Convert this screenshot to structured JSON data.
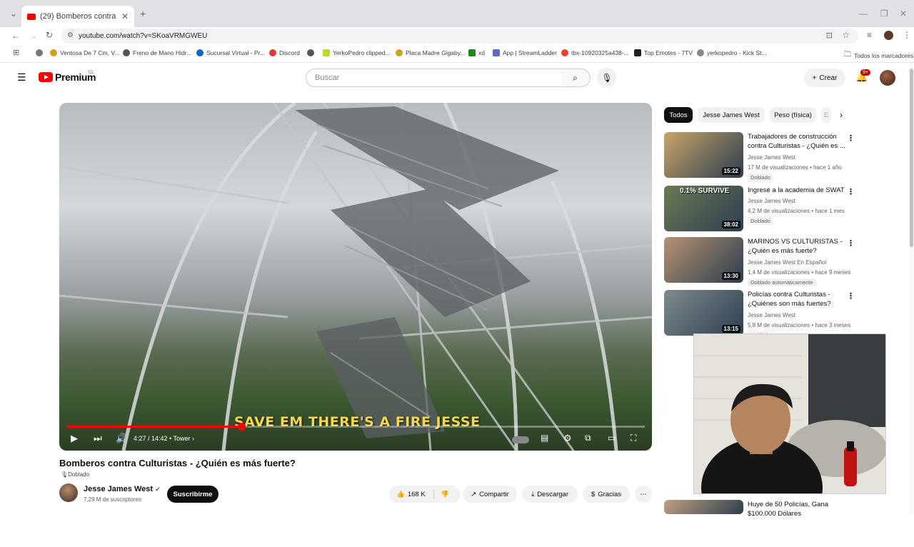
{
  "browser": {
    "tab_title": "(29) Bomberos contra Culturist",
    "url": "youtube.com/watch?v=SKoaVRMGWEU",
    "bookmarks": [
      {
        "label": "Ventosa De 7 Cm, V...",
        "color": "#d4a017"
      },
      {
        "label": "Freno de Mano Hidr...",
        "color": "#555555"
      },
      {
        "label": "Sucursal Virtual - Pr...",
        "color": "#1565c0"
      },
      {
        "label": "Discord",
        "color": "#e53935"
      },
      {
        "label": "",
        "color": "#555555"
      },
      {
        "label": "YerkoPedro clipped...",
        "color": "#c6d629"
      },
      {
        "label": "Placa Madre Gigaby...",
        "color": "#d4a017"
      },
      {
        "label": "xd",
        "color": "#1b8a1b"
      },
      {
        "label": "App | StreamLadder",
        "color": "#5c6bc0"
      },
      {
        "label": "tbx-10920325a438-...",
        "color": "#ea4335"
      },
      {
        "label": "Top Emotes - 7TV",
        "color": "#222222"
      },
      {
        "label": "yerkopedro - Kick St...",
        "color": "#888888"
      }
    ],
    "all_bookmarks": "Todos los marcadores"
  },
  "youtube": {
    "logo_text": "Premium",
    "logo_country": "CL",
    "search_placeholder": "Buscar",
    "create_label": "Crear",
    "notif_count": "9+"
  },
  "player": {
    "caption": "SAVE EM THERE'S A FIRE JESSE",
    "time": "4:27 / 14:42",
    "chapter": "• Tower ›",
    "progress_fraction": 0.302
  },
  "video": {
    "title": "Bomberos contra Culturistas - ¿Quién es más fuerte?",
    "dub_tag": "Doblado",
    "channel_name": "Jesse James West",
    "channel_subs": "7,29 M de suscriptores",
    "subscribe_label": "Suscribirme",
    "likes": "168 K",
    "share_label": "Compartir",
    "download_label": "Descargar",
    "thanks_label": "Gracias"
  },
  "sidebar": {
    "chips": [
      "Todos",
      "Jesse James West",
      "Peso (física)",
      "E"
    ],
    "recommendations": [
      {
        "title": "Trabajadores de construcción contra Culturistas - ¿Quién es ...",
        "channel": "Jesse James West",
        "meta": "17 M de visualizaciones • hace 1 año",
        "badge": "Doblado",
        "duration": "15:22",
        "overlay": "",
        "thumb": "#c9a46a"
      },
      {
        "title": "Ingresé a la academia de SWAT",
        "channel": "Jesse James West",
        "meta": "4,2 M de visualizaciones • hace 1 mes",
        "badge": "Doblado",
        "duration": "38:02",
        "overlay": "0.1% SURVIVE",
        "thumb": "#6c7a55"
      },
      {
        "title": "MARINOS VS CULTURISTAS - ¿Quién es más fuerte?",
        "channel": "Jesse James West En Español",
        "meta": "1,4 M de visualizaciones • hace 9 meses",
        "badge": "Doblado automáticamente",
        "duration": "13:30",
        "overlay": "",
        "thumb": "#b59272"
      },
      {
        "title": "Policías contra Culturistas - ¿Quiénes son más fuertes?",
        "channel": "Jesse James West",
        "meta": "5,8 M de visualizaciones • hace 3 meses",
        "badge": "Doblado",
        "duration": "13:15",
        "overlay": "",
        "thumb": "#7f8c8d"
      },
      {
        "title": "Huye de 50 Policías, Gana $100.000 Dólares",
        "channel": "",
        "meta": "",
        "badge": "",
        "duration": "",
        "overlay": "",
        "thumb": "#c0a080"
      }
    ]
  }
}
